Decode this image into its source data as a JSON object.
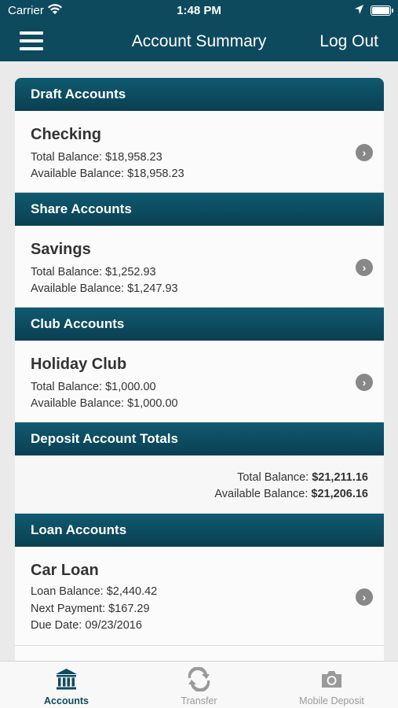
{
  "status_bar": {
    "carrier": "Carrier",
    "time": "1:48 PM"
  },
  "nav": {
    "title": "Account Summary",
    "logout_label": "Log Out"
  },
  "sections": {
    "draft": {
      "header": "Draft Accounts",
      "account": {
        "name": "Checking",
        "total": "Total Balance: $18,958.23",
        "available": "Available Balance: $18,958.23"
      }
    },
    "share": {
      "header": "Share Accounts",
      "account": {
        "name": "Savings",
        "total": "Total Balance: $1,252.93",
        "available": "Available Balance: $1,247.93"
      }
    },
    "club": {
      "header": "Club Accounts",
      "account": {
        "name": "Holiday Club",
        "total": "Total Balance: $1,000.00",
        "available": "Available Balance: $1,000.00"
      }
    },
    "deposit_totals": {
      "header": "Deposit Account Totals",
      "total_label": "Total Balance: ",
      "total_value": "$21,211.16",
      "available_label": "Available Balance: ",
      "available_value": "$21,206.16"
    },
    "loan": {
      "header": "Loan Accounts",
      "account": {
        "name": "Car Loan",
        "balance": "Loan Balance: $2,440.42",
        "next_payment": "Next Payment: $167.29",
        "due_date": "Due Date: 09/23/2016"
      }
    }
  },
  "tabs": [
    {
      "label": "Accounts",
      "icon": "bank-icon",
      "active": true
    },
    {
      "label": "Transfer",
      "icon": "transfer-icon",
      "active": false
    },
    {
      "label": "Mobile Deposit",
      "icon": "camera-icon",
      "active": false
    }
  ],
  "colors": {
    "brand": "#0e4a5e",
    "background": "#eaeaea",
    "inactive_tab": "#9a9a9a"
  }
}
